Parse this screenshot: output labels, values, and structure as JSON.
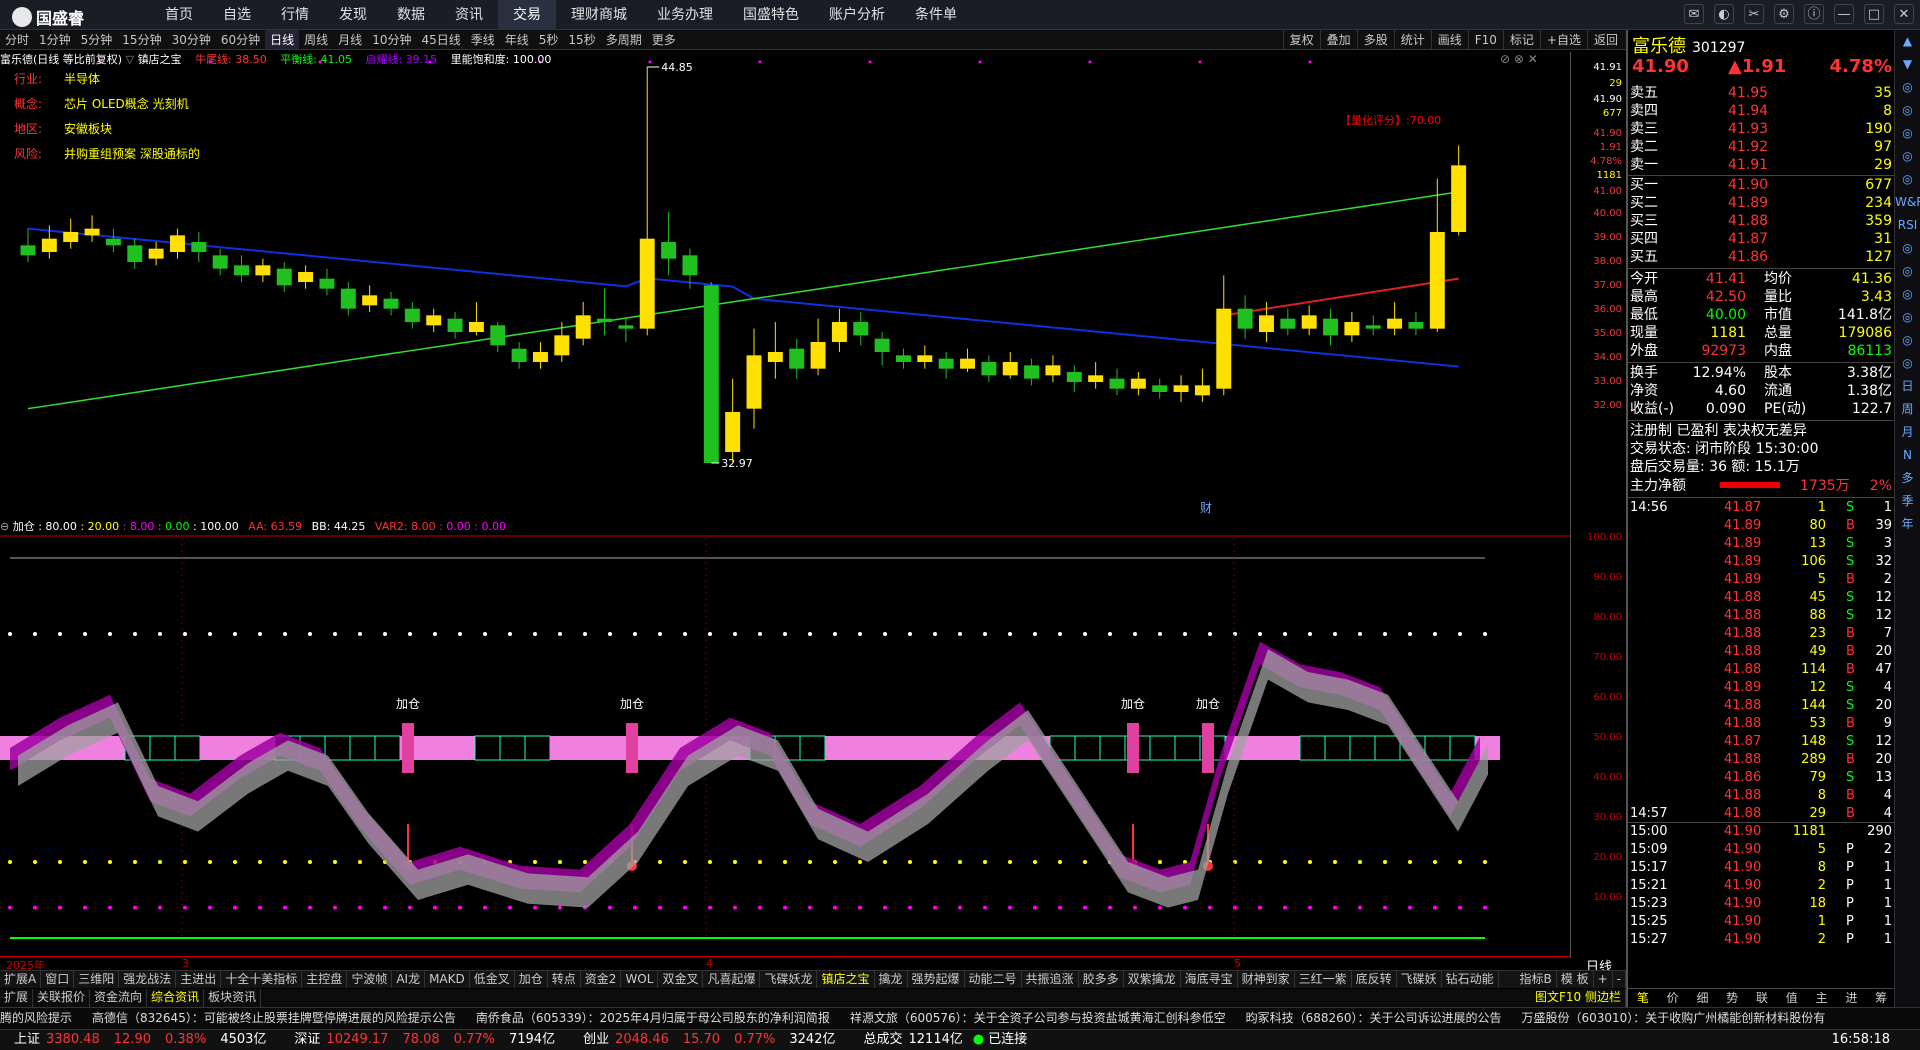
{
  "app": {
    "name": "国盛睿"
  },
  "menu": [
    "首页",
    "自选",
    "行情",
    "发现",
    "数据",
    "资讯",
    "交易",
    "理财商城",
    "业务办理",
    "国盛特色",
    "账户分析",
    "条件单"
  ],
  "menu_active": "交易",
  "periods": [
    "分时",
    "1分钟",
    "5分钟",
    "15分钟",
    "30分钟",
    "60分钟",
    "日线",
    "周线",
    "月线",
    "10分钟",
    "45日线",
    "季线",
    "年线",
    "5秒",
    "15秒",
    "多周期",
    "更多"
  ],
  "period_active": "日线",
  "toolbar": [
    "复权",
    "叠加",
    "多股",
    "统计",
    "画线",
    "F10",
    "标记",
    "+自选",
    "返回"
  ],
  "info": {
    "stock_label": "富乐德(日线 等比前复权)",
    "indicator": "镇店之宝",
    "l1": "牛尾线: 38.50",
    "l2": "平衡线: 41.05",
    "l3": "启耀线: 39.15",
    "l4": "里能饱和度: 100.00"
  },
  "notes": [
    {
      "k": "行业:",
      "v": "半导体"
    },
    {
      "k": "概念:",
      "v": "芯片 OLED概念 光刻机"
    },
    {
      "k": "地区:",
      "v": "安徽板块"
    },
    {
      "k": "风险:",
      "v": "并购重组预案 深股通标的"
    }
  ],
  "chart_labels": {
    "high": "44.85",
    "low": "32.97",
    "score": "【量化评分】:70.00",
    "fin": "财"
  },
  "yaxis": [
    "41.91",
    "29",
    "41.90",
    "677",
    "41.90",
    "1.91",
    "4.78%",
    "1181",
    "41.00",
    "40.00",
    "39.00",
    "38.00",
    "37.00",
    "36.00",
    "35.00",
    "34.00",
    "33.00",
    "32.00"
  ],
  "ind_header": {
    "name": "加仓",
    "v1": ": 80.00",
    "v2": ": 20.00",
    "v3": ": 8.00",
    "v4": ": 0.00",
    "v5": ": 100.00",
    "aa": "AA: 63.59",
    "bb": "BB: 44.25",
    "var2": "VAR2: 8.00",
    "v6": ": 0.00",
    "v7": ": 0.00"
  },
  "ind_labels": [
    "加仓",
    "加仓",
    "加仓",
    "加仓"
  ],
  "yaxis2": [
    "100.00",
    "90.00",
    "80.00",
    "70.00",
    "60.00",
    "50.00",
    "40.00",
    "30.00",
    "20.00",
    "10.00"
  ],
  "xaxis": [
    "2025年",
    "3",
    "4",
    "5"
  ],
  "xaxis_right": "日线",
  "tabs1": [
    "扩展A",
    "窗口",
    "三维阳",
    "强龙战法",
    "主进出",
    "十全十美指标",
    "主控盘",
    "宁波帧",
    "AI龙",
    "MAKD",
    "低金叉",
    "加仓",
    "转点",
    "资金2",
    "WOL",
    "双金叉",
    "凡喜起爆",
    "飞碟妖龙",
    "镇店之宝",
    "擒龙",
    "强势起爆",
    "动能二号",
    "共振追涨",
    "胶多多",
    "双紫擒龙",
    "海底寻宝",
    "财神到家",
    "三红一紫",
    "底反转",
    "飞碟妖",
    "钻石动能"
  ],
  "tabs1_right": [
    "指标B",
    "模 板",
    "+",
    "-"
  ],
  "tabs2": [
    "扩展",
    "关联报价",
    "资金流向",
    "综合资讯",
    "板块资讯"
  ],
  "tabs2_right": "图文F10 侧边栏",
  "news": [
    "腾的风险提示",
    "高德信（832645）：可能被终止股票挂牌暨停牌进展的风险提示公告",
    "南侨食品（605339）：2025年4月归属于母公司股东的净利润简报",
    "祥源文旅（600576）：关于全资子公司参与投资盐城黄海汇创科参低空",
    "昀冢科技（688260）：关于公司诉讼进展的公告",
    "万盛股份（603010）：关于收购广州橘能创新材料股份有"
  ],
  "status": [
    {
      "n": "上证",
      "v": "3380.48",
      "c": "12.90",
      "p": "0.38%",
      "a": "4503亿"
    },
    {
      "n": "深证",
      "v": "10249.17",
      "c": "78.08",
      "p": "0.77%",
      "a": "7194亿"
    },
    {
      "n": "创业",
      "v": "2048.46",
      "c": "15.70",
      "p": "0.77%",
      "a": "3242亿"
    }
  ],
  "status_total": {
    "k": "总成交",
    "v": "12114亿"
  },
  "status_conn": "已连接",
  "status_time": "16:58:18",
  "quote": {
    "name": "富乐德",
    "code": "301297",
    "price": "41.90",
    "change": "▲1.91",
    "pct": "4.78%"
  },
  "asks": [
    {
      "l": "卖五",
      "p": "41.95",
      "v": "35"
    },
    {
      "l": "卖四",
      "p": "41.94",
      "v": "8"
    },
    {
      "l": "卖三",
      "p": "41.93",
      "v": "190"
    },
    {
      "l": "卖二",
      "p": "41.92",
      "v": "97"
    },
    {
      "l": "卖一",
      "p": "41.91",
      "v": "29"
    }
  ],
  "bids": [
    {
      "l": "买一",
      "p": "41.90",
      "v": "677"
    },
    {
      "l": "买二",
      "p": "41.89",
      "v": "234"
    },
    {
      "l": "买三",
      "p": "41.88",
      "v": "359"
    },
    {
      "l": "买四",
      "p": "41.87",
      "v": "31"
    },
    {
      "l": "买五",
      "p": "41.86",
      "v": "127"
    }
  ],
  "stats": [
    [
      "今开",
      "41.41",
      "均价",
      "41.36"
    ],
    [
      "最高",
      "42.50",
      "量比",
      "3.43"
    ],
    [
      "最低",
      "40.00",
      "市值",
      "141.8亿"
    ],
    [
      "现量",
      "1181",
      "总量",
      "179086"
    ],
    [
      "外盘",
      "92973",
      "内盘",
      "86113"
    ]
  ],
  "stats2": [
    [
      "换手",
      "12.94%",
      "股本",
      "3.38亿"
    ],
    [
      "净资",
      "4.60",
      "流通",
      "1.38亿"
    ],
    [
      "收益(-)",
      "0.090",
      "PE(动)",
      "122.7"
    ]
  ],
  "reg": "注册制 已盈利 表决权无差异",
  "trade_state": "交易状态: 闭市阶段 15:30:00",
  "after": "盘后交易量: 36  额: 15.1万",
  "main_net": {
    "k": "主力净额",
    "v": "1735万",
    "p": "2%"
  },
  "ticks": [
    [
      "14:56",
      "41.87",
      "1",
      "S",
      "1"
    ],
    [
      "",
      "41.89",
      "80",
      "B",
      "39"
    ],
    [
      "",
      "41.89",
      "13",
      "S",
      "3"
    ],
    [
      "",
      "41.89",
      "106",
      "S",
      "32"
    ],
    [
      "",
      "41.89",
      "5",
      "B",
      "2"
    ],
    [
      "",
      "41.88",
      "45",
      "S",
      "12"
    ],
    [
      "",
      "41.88",
      "88",
      "S",
      "12"
    ],
    [
      "",
      "41.88",
      "23",
      "B",
      "7"
    ],
    [
      "",
      "41.88",
      "49",
      "B",
      "20"
    ],
    [
      "",
      "41.88",
      "114",
      "B",
      "47"
    ],
    [
      "",
      "41.89",
      "12",
      "S",
      "4"
    ],
    [
      "",
      "41.88",
      "144",
      "S",
      "20"
    ],
    [
      "",
      "41.88",
      "53",
      "B",
      "9"
    ],
    [
      "",
      "41.87",
      "148",
      "S",
      "12"
    ],
    [
      "",
      "41.88",
      "289",
      "B",
      "20"
    ],
    [
      "",
      "41.86",
      "79",
      "S",
      "13"
    ],
    [
      "",
      "41.88",
      "8",
      "B",
      "4"
    ],
    [
      "14:57",
      "41.88",
      "29",
      "B",
      "4"
    ],
    [
      "15:00",
      "41.90",
      "1181",
      "",
      "290"
    ],
    [
      "15:09",
      "41.90",
      "5",
      "P",
      "2"
    ],
    [
      "15:17",
      "41.90",
      "8",
      "P",
      "1"
    ],
    [
      "15:21",
      "41.90",
      "2",
      "P",
      "1"
    ],
    [
      "15:23",
      "41.90",
      "18",
      "P",
      "1"
    ],
    [
      "15:25",
      "41.90",
      "1",
      "P",
      "1"
    ],
    [
      "15:27",
      "41.90",
      "2",
      "P",
      "1"
    ]
  ],
  "bottom_tabs": [
    "笔",
    "价",
    "细",
    "势",
    "联",
    "值",
    "主",
    "进",
    "筹"
  ],
  "side": [
    "▲",
    "▼",
    "◎",
    "◎",
    "◎",
    "◎",
    "◎",
    "W&R",
    "RSI",
    "◎",
    "◎",
    "◎",
    "◎",
    "◎",
    "◎",
    "日",
    "周",
    "月",
    "N",
    "多",
    "季",
    "年"
  ],
  "chart_data": {
    "type": "candlestick",
    "y_range": [
      31.5,
      45
    ],
    "candles": [
      [
        39.5,
        39.2,
        40.0,
        39.0
      ],
      [
        39.3,
        39.7,
        40.1,
        39.1
      ],
      [
        39.6,
        39.9,
        40.3,
        39.4
      ],
      [
        39.8,
        40.0,
        40.4,
        39.6
      ],
      [
        39.7,
        39.5,
        40.0,
        39.3
      ],
      [
        39.5,
        39.0,
        39.7,
        38.8
      ],
      [
        39.1,
        39.4,
        39.6,
        38.9
      ],
      [
        39.3,
        39.8,
        40.0,
        39.1
      ],
      [
        39.6,
        39.3,
        39.9,
        39.0
      ],
      [
        39.2,
        38.8,
        39.4,
        38.6
      ],
      [
        38.9,
        38.6,
        39.2,
        38.4
      ],
      [
        38.6,
        38.9,
        39.1,
        38.4
      ],
      [
        38.8,
        38.3,
        39.0,
        38.1
      ],
      [
        38.4,
        38.7,
        38.9,
        38.2
      ],
      [
        38.5,
        38.2,
        38.8,
        38.0
      ],
      [
        38.2,
        37.6,
        38.4,
        37.4
      ],
      [
        37.7,
        38.0,
        38.3,
        37.5
      ],
      [
        37.9,
        37.6,
        38.1,
        37.4
      ],
      [
        37.6,
        37.2,
        37.8,
        37.0
      ],
      [
        37.1,
        37.4,
        37.6,
        36.9
      ],
      [
        37.3,
        36.9,
        37.5,
        36.7
      ],
      [
        36.9,
        37.2,
        37.8,
        36.8
      ],
      [
        37.1,
        36.5,
        37.2,
        36.3
      ],
      [
        36.4,
        36.0,
        36.6,
        35.8
      ],
      [
        36.0,
        36.3,
        36.6,
        35.8
      ],
      [
        36.2,
        36.8,
        37.2,
        36.0
      ],
      [
        36.7,
        37.4,
        37.8,
        36.5
      ],
      [
        37.3,
        37.2,
        38.2,
        36.8
      ],
      [
        37.1,
        37.0,
        37.3,
        36.6
      ],
      [
        37.0,
        39.7,
        44.85,
        36.8
      ],
      [
        39.6,
        39.1,
        40.5,
        38.6
      ],
      [
        39.2,
        38.6,
        39.4,
        38.2
      ],
      [
        38.3,
        32.97,
        38.4,
        32.97
      ],
      [
        33.3,
        34.5,
        35.5,
        33.0
      ],
      [
        34.6,
        36.2,
        37.0,
        34.0
      ],
      [
        36.0,
        36.3,
        37.2,
        35.5
      ],
      [
        36.4,
        35.8,
        36.7,
        35.5
      ],
      [
        35.8,
        36.6,
        37.3,
        35.6
      ],
      [
        36.6,
        37.2,
        37.6,
        36.3
      ],
      [
        37.2,
        36.8,
        37.5,
        36.5
      ],
      [
        36.7,
        36.3,
        36.9,
        35.9
      ],
      [
        36.2,
        36.0,
        36.4,
        35.8
      ],
      [
        36.0,
        36.2,
        36.5,
        35.8
      ],
      [
        36.1,
        35.8,
        36.3,
        35.5
      ],
      [
        35.8,
        36.1,
        36.4,
        35.7
      ],
      [
        36.0,
        35.6,
        36.2,
        35.4
      ],
      [
        35.6,
        36.0,
        36.3,
        35.5
      ],
      [
        35.9,
        35.5,
        36.1,
        35.3
      ],
      [
        35.6,
        35.9,
        36.2,
        35.4
      ],
      [
        35.7,
        35.4,
        35.9,
        35.1
      ],
      [
        35.4,
        35.6,
        36.0,
        35.2
      ],
      [
        35.5,
        35.2,
        35.8,
        35.0
      ],
      [
        35.2,
        35.5,
        35.7,
        35.0
      ],
      [
        35.3,
        35.1,
        35.5,
        34.9
      ],
      [
        35.1,
        35.3,
        35.6,
        34.8
      ],
      [
        35.0,
        35.3,
        35.8,
        34.8
      ],
      [
        35.2,
        37.6,
        38.6,
        35.0
      ],
      [
        37.6,
        37.0,
        38.0,
        36.7
      ],
      [
        36.9,
        37.4,
        37.8,
        36.6
      ],
      [
        37.3,
        37.0,
        37.6,
        36.8
      ],
      [
        37.0,
        37.4,
        37.7,
        36.8
      ],
      [
        37.3,
        36.8,
        37.6,
        36.5
      ],
      [
        36.8,
        37.2,
        37.5,
        36.6
      ],
      [
        37.1,
        37.0,
        37.4,
        36.8
      ],
      [
        37.0,
        37.3,
        37.8,
        36.8
      ],
      [
        37.2,
        37.0,
        37.5,
        36.8
      ],
      [
        37.0,
        39.9,
        41.5,
        36.9
      ],
      [
        39.9,
        41.9,
        42.5,
        39.8
      ]
    ]
  },
  "gauge": {
    "aa": 63.59,
    "bb": 44.25
  }
}
